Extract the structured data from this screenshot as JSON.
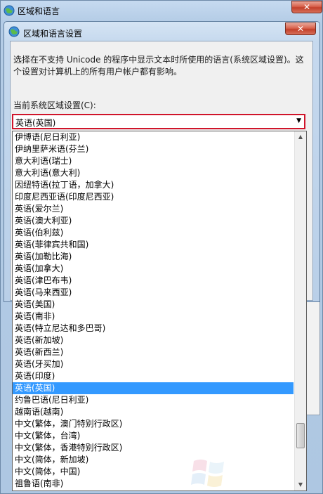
{
  "window": {
    "title": "区域和语言",
    "close_label": "✕"
  },
  "dialog": {
    "title": "区域和语言设置",
    "ghost_text": "...",
    "close_label": "✕",
    "description": "选择在不支持 Unicode 的程序中显示文本时所使用的语言(系统区域设置)。这个设置对计算机上的所有用户帐户都有影响。",
    "current_label": "当前系统区域设置(C):",
    "combo_value": "英语(英国)",
    "combo_arrow": "▼"
  },
  "dropdown": {
    "items": [
      "伊博语(尼日利亚)",
      "伊纳里萨米语(芬兰)",
      "意大利语(瑞士)",
      "意大利语(意大利)",
      "因纽特语(拉丁语，加拿大)",
      "印度尼西亚语(印度尼西亚)",
      "英语(爱尔兰)",
      "英语(澳大利亚)",
      "英语(伯利兹)",
      "英语(菲律宾共和国)",
      "英语(加勒比海)",
      "英语(加拿大)",
      "英语(津巴布韦)",
      "英语(马来西亚)",
      "英语(美国)",
      "英语(南非)",
      "英语(特立尼达和多巴哥)",
      "英语(新加坡)",
      "英语(新西兰)",
      "英语(牙买加)",
      "英语(印度)",
      "英语(英国)",
      "约鲁巴语(尼日利亚)",
      "越南语(越南)",
      "中文(繁体，澳门特别行政区)",
      "中文(繁体，台湾)",
      "中文(繁体，香港特别行政区)",
      "中文(简体，新加坡)",
      "中文(简体，中国)",
      "祖鲁语(南非)"
    ],
    "selected_index": 21,
    "scroll_up": "▲",
    "scroll_down": "▼"
  },
  "colors": {
    "selection": "#3399ff",
    "combo_border": "#d0142a",
    "close_button": "#c2402a"
  },
  "icons": {
    "window_icon": "globe-icon",
    "dialog_icon": "globe-icon",
    "watermark": "windows-logo-icon"
  }
}
